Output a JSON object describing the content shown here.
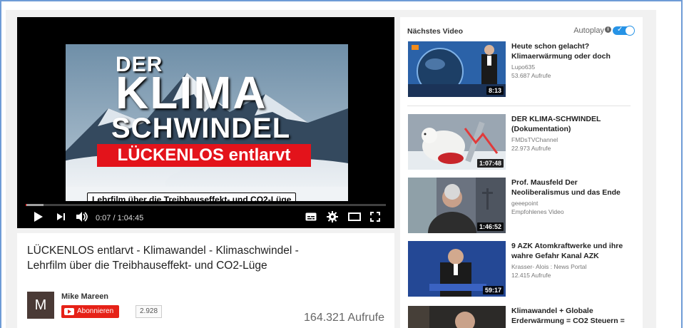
{
  "player": {
    "thumbnail": {
      "line1": "DER",
      "line2": "KLIMA",
      "line3": "SCHWINDEL",
      "banner": "LÜCKENLOS entlarvt",
      "subtitle": "Lehrfilm über die Treibhauseffekt- und CO2-Lüge"
    },
    "time": "0:07 / 1:04:45",
    "progress_fraction": 0.002,
    "buffered_fraction": 0.05,
    "icons": [
      "play-icon",
      "next-icon",
      "volume-icon",
      "subtitles-icon",
      "settings-icon",
      "theater-mode-icon",
      "fullscreen-icon"
    ]
  },
  "video": {
    "title": "LÜCKENLOS entlarvt - Klimawandel - Klimaschwindel - Lehrfilm über die Treibhauseffekt- und CO2-Lüge",
    "channel": "Mike Mareen",
    "avatar_letter": "M",
    "subscribe_label": "Abonnieren",
    "subscriber_count": "2.928",
    "views": "164.321 Aufrufe"
  },
  "sidebar": {
    "heading": "Nächstes Video",
    "autoplay_label": "Autoplay",
    "autoplay_on": true,
    "items": [
      {
        "title": "Heute schon gelacht? Klimaerwärmung oder doch",
        "channel": "Lupo635",
        "meta": "53.687 Aufrufe",
        "duration": "8:13"
      },
      {
        "title": "DER KLIMA-SCHWINDEL (Dokumentation)",
        "channel": "FMDsTVChannel",
        "meta": "22.973 Aufrufe",
        "duration": "1:07:48"
      },
      {
        "title": "Prof. Mausfeld Der Neoliberalismus und das Ende",
        "channel": "geeepoint",
        "meta": "Empfohlenes Video",
        "duration": "1:46:52"
      },
      {
        "title": "9 AZK Atomkraftwerke und ihre wahre Gefahr Kanal AZK",
        "channel": "Krasser- Alois : News Portal",
        "meta": "12.415 Aufrufe",
        "duration": "59:17"
      },
      {
        "title": "Klimawandel + Globale Erderwärmung = CO2 Steuern =",
        "channel": "",
        "meta": "",
        "duration": ""
      }
    ]
  },
  "colors": {
    "accent_red": "#e3131b",
    "subscribe_red": "#e62117",
    "toggle_blue": "#2793e6",
    "page_bg": "#f1f1f1"
  }
}
